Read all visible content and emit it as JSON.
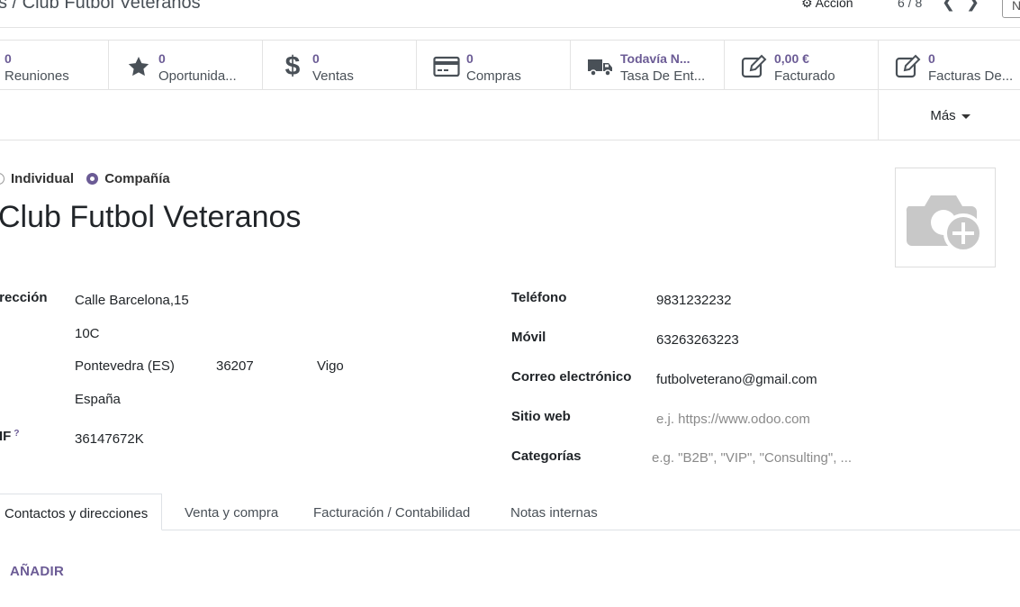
{
  "control_panel": {
    "breadcrumb": "s / Club Futbol Veteranos",
    "action_label": "Acción",
    "pager": "6 / 8",
    "new_button_label": "N"
  },
  "stat_buttons": [
    {
      "value": "0",
      "label": "Reuniones",
      "icon": "calendar-icon"
    },
    {
      "value": "0",
      "label": "Oportunida...",
      "icon": "star-icon"
    },
    {
      "value": "0",
      "label": "Ventas",
      "icon": "dollar-icon"
    },
    {
      "value": "0",
      "label": "Compras",
      "icon": "credit-card-icon"
    },
    {
      "value": "Todavía N...",
      "label": "Tasa De Ent...",
      "icon": "truck-icon"
    },
    {
      "value": "0,00 €",
      "label": "Facturado",
      "icon": "edit-icon"
    },
    {
      "value": "0",
      "label": "Facturas De...",
      "icon": "edit-icon"
    }
  ],
  "more_label": "Más",
  "company_type": {
    "options": [
      "Individual",
      "Compañía"
    ],
    "selected": "Compañía"
  },
  "partner_name": "Club Futbol Veteranos",
  "address": {
    "label": "irección",
    "street": "Calle Barcelona,15",
    "street2": "10C",
    "state": "Pontevedra (ES)",
    "zip": "36207",
    "city": "Vigo",
    "country": "España"
  },
  "vat": {
    "label": "IF",
    "help": "?",
    "value": "36147672K"
  },
  "contact": {
    "phone_label": "Teléfono",
    "phone": "9831232232",
    "mobile_label": "Móvil",
    "mobile": "63263263223",
    "email_label": "Correo electrónico",
    "email": "futbolveterano@gmail.com",
    "website_label": "Sitio web",
    "website_placeholder": "e.j. https://www.odoo.com",
    "tags_label": "Categorías",
    "tags_placeholder": "e.g. \"B2B\", \"VIP\", \"Consulting\", ..."
  },
  "tabs": [
    "Contactos y direcciones",
    "Venta y compra",
    "Facturación / Contabilidad",
    "Notas internas"
  ],
  "active_tab": "Contactos y direcciones",
  "add_label": "AÑADIR",
  "colors": {
    "accent": "#6b5b95",
    "text": "#212529",
    "muted": "#495057",
    "border": "#e3e3e3"
  }
}
